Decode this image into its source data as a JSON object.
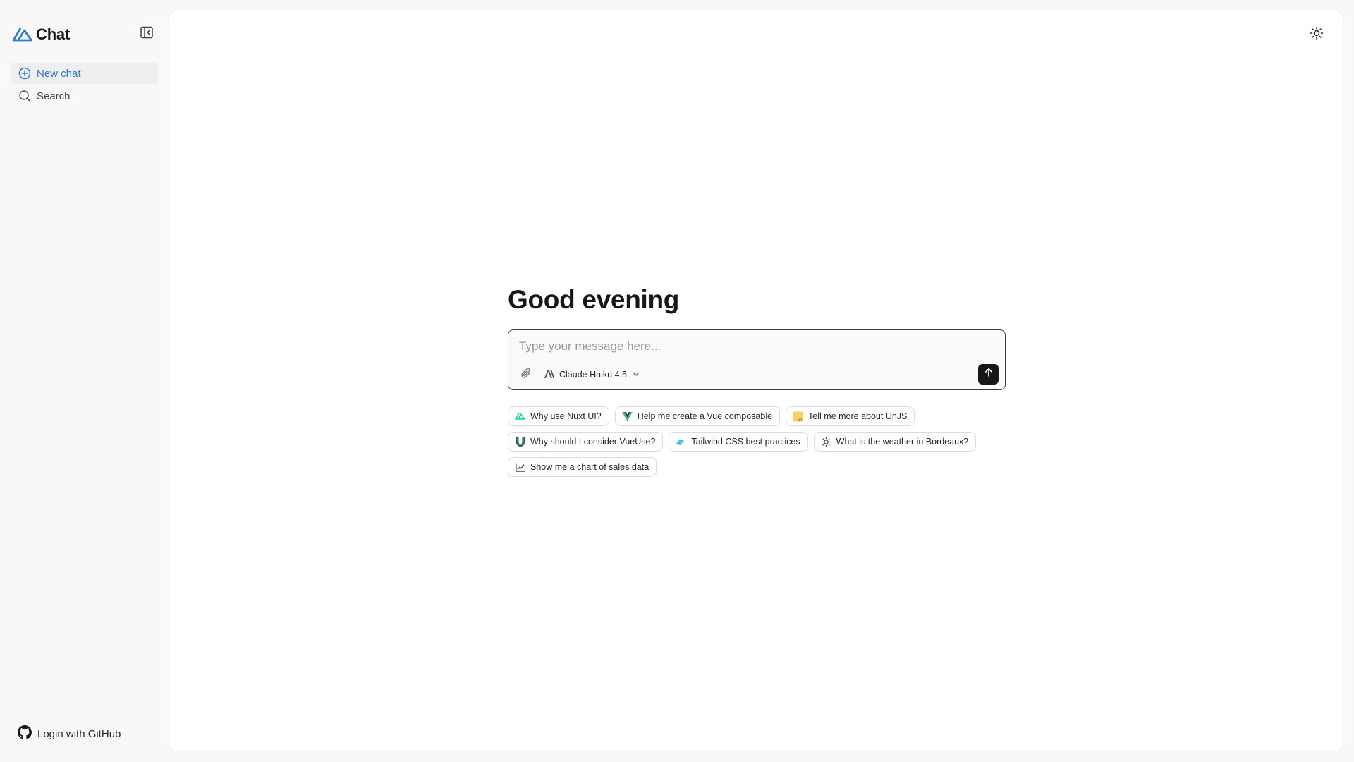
{
  "app": {
    "title": "Chat"
  },
  "sidebar": {
    "items": [
      {
        "label": "New chat",
        "icon": "plus-circle-icon",
        "active": true
      },
      {
        "label": "Search",
        "icon": "search-icon",
        "active": false
      }
    ],
    "login_label": "Login with GitHub"
  },
  "main": {
    "greeting": "Good evening",
    "input": {
      "placeholder": "Type your message here...",
      "value": ""
    },
    "model": {
      "label": "Claude Haiku 4.5"
    },
    "suggestions": [
      {
        "label": "Why use Nuxt UI?",
        "icon": "nuxt-icon"
      },
      {
        "label": "Help me create a Vue composable",
        "icon": "vue-icon"
      },
      {
        "label": "Tell me more about UnJS",
        "icon": "unjs-icon"
      },
      {
        "label": "Why should I consider VueUse?",
        "icon": "vueuse-icon"
      },
      {
        "label": "Tailwind CSS best practices",
        "icon": "tailwind-icon"
      },
      {
        "label": "What is the weather in Bordeaux?",
        "icon": "sun-icon"
      },
      {
        "label": "Show me a chart of sales data",
        "icon": "line-chart-icon"
      }
    ]
  },
  "colors": {
    "accent": "#2d7fd0",
    "nuxt_green": "#00dc82",
    "vue_green": "#41b883",
    "vue_dark": "#35495e",
    "unjs_yellow": "#f4d35e",
    "tailwind_cyan": "#38bdf8",
    "send_bg": "#171717"
  }
}
